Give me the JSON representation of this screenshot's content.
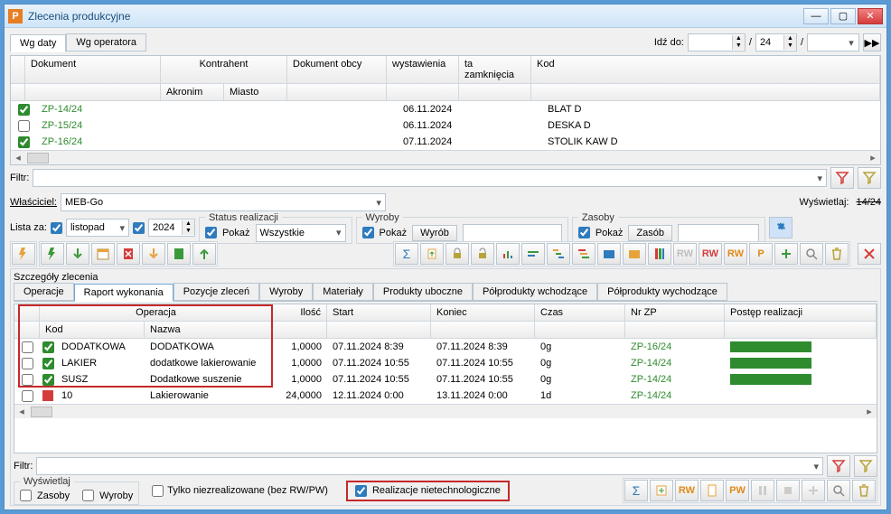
{
  "window": {
    "icon": "P",
    "title": "Zlecenia produkcyjne"
  },
  "tabs": {
    "date": "Wg daty",
    "operator": "Wg operatora"
  },
  "goto": {
    "label": "Idź do:",
    "val1": "",
    "val2": "24",
    "val3": ""
  },
  "maingrid": {
    "headers": {
      "document": "Dokument",
      "contractor": "Kontrahent",
      "akronim": "Akronim",
      "miasto": "Miasto",
      "docext": "Dokument obcy",
      "issued": "wystawienia",
      "closed": "ta zamknięcia",
      "code": "Kod"
    },
    "rows": [
      {
        "checked": true,
        "doc": "ZP-14/24",
        "issued": "06.11.2024",
        "code": "BLAT D"
      },
      {
        "checked": false,
        "doc": "ZP-15/24",
        "issued": "06.11.2024",
        "code": "DESKA D"
      },
      {
        "checked": true,
        "doc": "ZP-16/24",
        "issued": "07.11.2024",
        "code": "STOLIK KAW D"
      }
    ]
  },
  "filter": {
    "label": "Filtr:"
  },
  "owner": {
    "label": "Właściciel:",
    "value": "MEB-Go"
  },
  "display": {
    "label": "Wyświetlaj:",
    "struck": "14/24"
  },
  "criteria": {
    "listfor": "Lista za:",
    "month": "listopad",
    "year": "2024",
    "status_legend": "Status realizacji",
    "show": "Pokaż",
    "status_value": "Wszystkie",
    "products_legend": "Wyroby",
    "product_btn": "Wyrób",
    "resources_legend": "Zasoby",
    "resource_btn": "Zasób"
  },
  "details": {
    "title": "Szczegóły zlecenia",
    "tabs": {
      "operacje": "Operacje",
      "raport": "Raport wykonania",
      "pozycje": "Pozycje zleceń",
      "wyroby": "Wyroby",
      "materialy": "Materiały",
      "uboczne": "Produkty uboczne",
      "polin": "Półprodukty wchodzące",
      "polout": "Półprodukty wychodzące"
    },
    "opcols": {
      "operacja": "Operacja",
      "kod": "Kod",
      "nazwa": "Nazwa",
      "ilosc": "Ilość",
      "start": "Start",
      "koniec": "Koniec",
      "czas": "Czas",
      "nrzp": "Nr ZP",
      "postep": "Postęp realizacji"
    },
    "ops": [
      {
        "kod": "DODATKOWA",
        "nazwa": "DODATKOWA",
        "ilosc": "1,0000",
        "start": "07.11.2024 8:39",
        "koniec": "07.11.2024 8:39",
        "czas": "0g",
        "nrzp": "ZP-16/24",
        "full": true,
        "extra": true
      },
      {
        "kod": "LAKIER",
        "nazwa": "dodatkowe lakierowanie",
        "ilosc": "1,0000",
        "start": "07.11.2024 10:55",
        "koniec": "07.11.2024 10:55",
        "czas": "0g",
        "nrzp": "ZP-14/24",
        "full": true,
        "extra": true
      },
      {
        "kod": "SUSZ",
        "nazwa": "Dodatkowe suszenie",
        "ilosc": "1,0000",
        "start": "07.11.2024 10:55",
        "koniec": "07.11.2024 10:55",
        "czas": "0g",
        "nrzp": "ZP-14/24",
        "full": true,
        "extra": true
      },
      {
        "kod": "10",
        "nazwa": "Lakierowanie",
        "ilosc": "24,0000",
        "start": "12.11.2024 0:00",
        "koniec": "13.11.2024 0:00",
        "czas": "1d",
        "nrzp": "ZP-14/24",
        "full": false,
        "red": true
      }
    ]
  },
  "bottom": {
    "wyswietlaj": "Wyświetlaj",
    "zasoby": "Zasoby",
    "wyroby": "Wyroby",
    "tylko": "Tylko niezrealizowane (bez RW/PW)",
    "realiz": "Realizacje nietechnologiczne"
  }
}
